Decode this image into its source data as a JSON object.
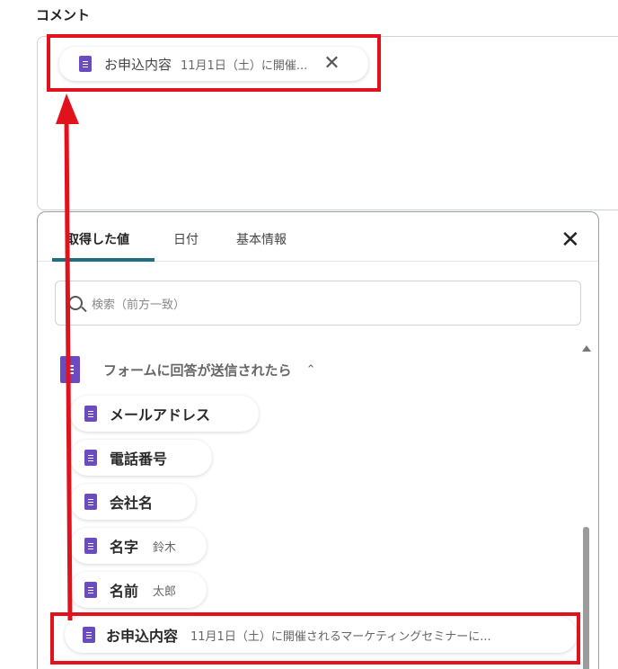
{
  "comment_label": "コメント",
  "top_chip": {
    "label": "お申込内容",
    "value": "11月1日（土）に開催...",
    "close": "✕"
  },
  "tabs": [
    {
      "label": "取得した値",
      "active": true
    },
    {
      "label": "日付",
      "active": false
    },
    {
      "label": "基本情報",
      "active": false
    }
  ],
  "panel_close": "✕",
  "search": {
    "placeholder": "検索（前方一致）"
  },
  "section": {
    "title": "フォームに回答が送信されたら",
    "chevron": "⌃"
  },
  "items": [
    {
      "label": "メールアドレス",
      "value": ""
    },
    {
      "label": "電話番号",
      "value": ""
    },
    {
      "label": "会社名",
      "value": ""
    },
    {
      "label": "名字",
      "value": "鈴木"
    },
    {
      "label": "名前",
      "value": "太郎"
    },
    {
      "label": "お申込内容",
      "value": "11月1日（土）に開催されるマーケティングセミナーに..."
    }
  ],
  "colors": {
    "highlight": "#e1121b",
    "icon": "#6b4cc0",
    "tab_accent": "#1f6e84"
  }
}
